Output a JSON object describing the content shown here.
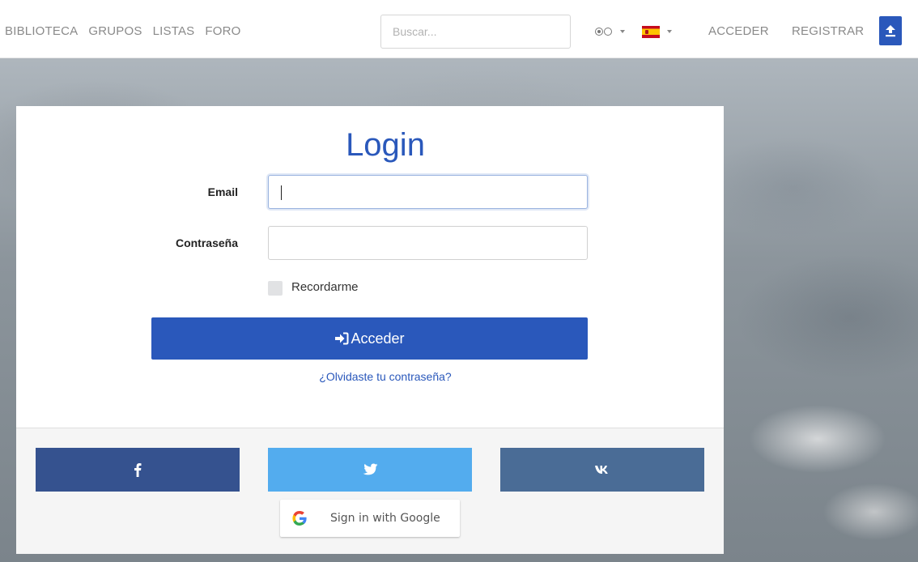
{
  "nav": {
    "links": [
      "BIBLIOTECA",
      "GRUPOS",
      "LISTAS",
      "FORO"
    ],
    "search_placeholder": "Buscar...",
    "login_label": "ACCEDER",
    "register_label": "REGISTRAR",
    "accent": "#2a58bb"
  },
  "login": {
    "title": "Login",
    "email_label": "Email",
    "email_value": "",
    "password_label": "Contraseña",
    "password_value": "",
    "remember_label": "Recordarme",
    "remember_checked": false,
    "submit_label": "Acceder",
    "forgot_label": "¿Olvidaste tu contraseña?"
  },
  "social": {
    "facebook_color": "#35528f",
    "twitter_color": "#53acee",
    "vk_color": "#4a6c96",
    "google_label": "Sign in with Google"
  }
}
